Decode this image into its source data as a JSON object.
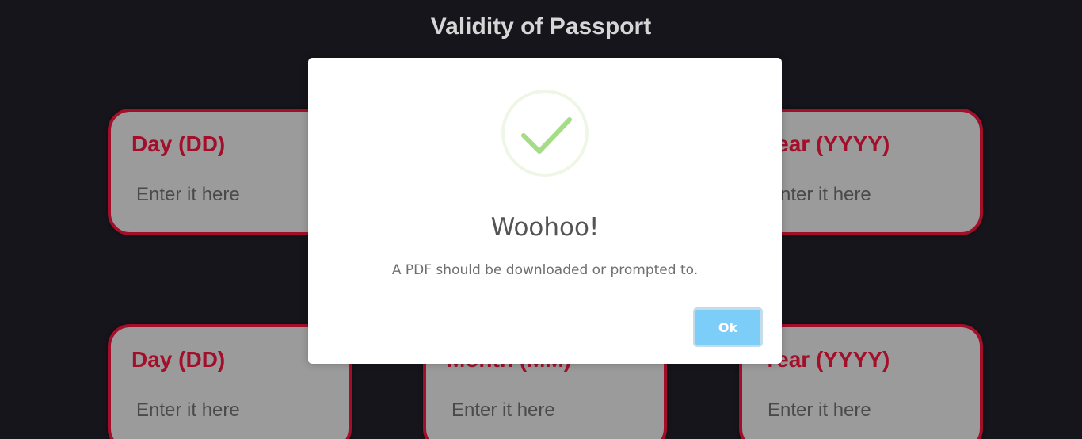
{
  "section": {
    "title": "Validity of Passport"
  },
  "rows": [
    {
      "day": {
        "label": "Day (DD)",
        "placeholder": "Enter it here"
      },
      "year": {
        "label": "Year (YYYY)",
        "placeholder": "Enter it here"
      }
    },
    {
      "day": {
        "label": "Day (DD)",
        "placeholder": "Enter it here"
      },
      "month": {
        "label": "Month (MM)",
        "placeholder": "Enter it here"
      },
      "year": {
        "label": "Year (YYYY)",
        "placeholder": "Enter it here"
      }
    }
  ],
  "modal": {
    "icon": "checkmark-icon",
    "title": "Woohoo!",
    "text": "A PDF should be downloaded or prompted to.",
    "ok_label": "Ok"
  },
  "colors": {
    "background": "#16151b",
    "card_border": "#a30f2a",
    "card_fill": "#9b9b9b",
    "success_green": "#a5dc86",
    "ok_button": "#7dcdf9"
  }
}
